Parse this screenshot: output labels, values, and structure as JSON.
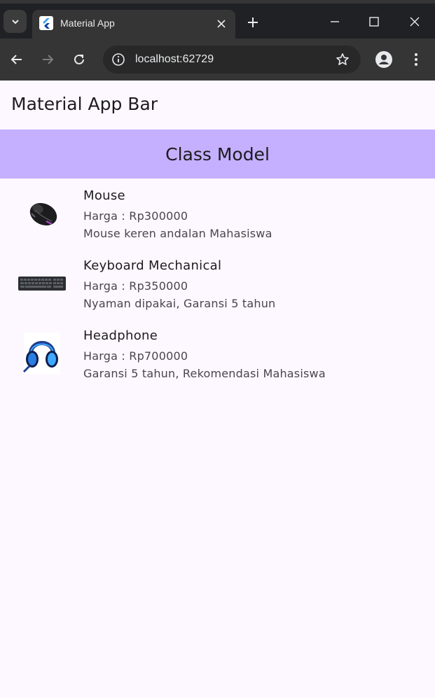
{
  "browser": {
    "tab_title": "Material App",
    "url": "localhost:62729",
    "accent_color": "#c4b0fe"
  },
  "app": {
    "appbar_title": "Material App Bar",
    "section_title": "Class Model",
    "items": [
      {
        "name": "Mouse",
        "price": "Harga : Rp300000",
        "description": "Mouse keren andalan Mahasiswa",
        "image_icon": "mouse-image"
      },
      {
        "name": "Keyboard Mechanical",
        "price": "Harga : Rp350000",
        "description": "Nyaman dipakai, Garansi 5 tahun",
        "image_icon": "keyboard-image"
      },
      {
        "name": "Headphone",
        "price": "Harga : Rp700000",
        "description": "Garansi 5 tahun, Rekomendasi Mahasiswa",
        "image_icon": "headphone-image"
      }
    ]
  }
}
